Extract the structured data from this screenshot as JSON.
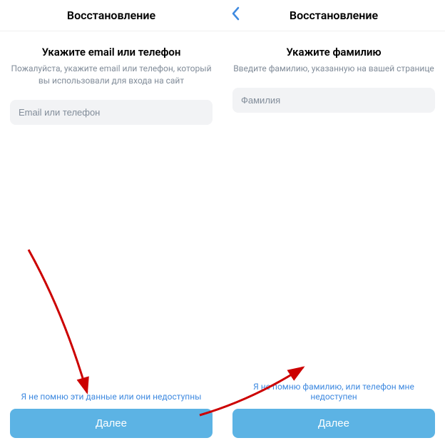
{
  "screens": {
    "left": {
      "header": {
        "title": "Восстановление"
      },
      "main_title": "Укажите email или телефон",
      "subtitle": "Пожалуйста, укажите email или телефон, который вы использовали для входа на сайт",
      "input_placeholder": "Email или телефон",
      "link_text": "Я не помню эти данные или они недоступны",
      "button_label": "Далее"
    },
    "right": {
      "header": {
        "title": "Восстановление"
      },
      "main_title": "Укажите фамилию",
      "subtitle": "Введите фамилию, указанную на вашей странице",
      "input_placeholder": "Фамилия",
      "link_text": "Я не помню фамилию, или телефон мне недоступен",
      "button_label": "Далее"
    }
  },
  "colors": {
    "accent": "#3f8ae0",
    "button": "#5cb3e4",
    "subtext": "#818c99",
    "input_bg": "#f2f3f5",
    "arrow": "#cc0000"
  }
}
